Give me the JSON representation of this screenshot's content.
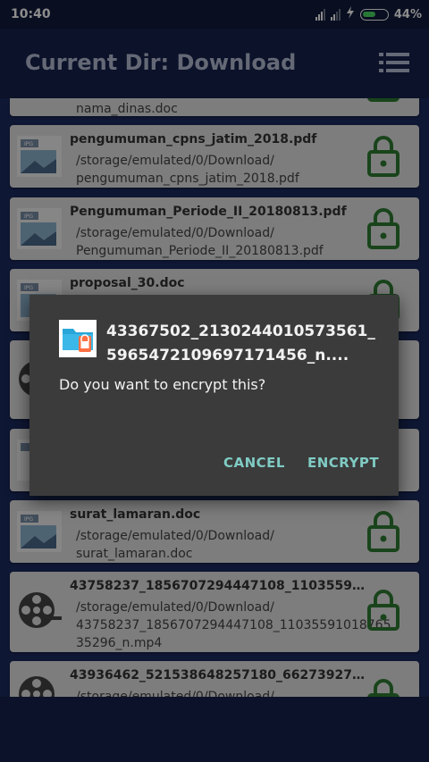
{
  "status_bar": {
    "time": "10:40",
    "battery": "44%"
  },
  "app_bar": {
    "title": "Current Dir: Download"
  },
  "files": [
    {
      "name": "",
      "path_line1": "",
      "path_line2": "nama_dinas.doc"
    },
    {
      "name": "pengumuman_cpns_jatim_2018.pdf",
      "path_line1": "/storage/emulated/0/Download/",
      "path_line2": "pengumuman_cpns_jatim_2018.pdf"
    },
    {
      "name": "Pengumuman_Periode_II_20180813.pdf",
      "path_line1": "/storage/emulated/0/Download/",
      "path_line2": "Pengumuman_Periode_II_20180813.pdf"
    },
    {
      "name": "proposal_30.doc",
      "path_line1": "",
      "path_line2": ""
    },
    {
      "name": "surat_lamaran.doc",
      "path_line1": "/storage/emulated/0/Download/",
      "path_line2": "surat_lamaran.doc"
    },
    {
      "name": "43758237_1856707294447108_11035591...",
      "path_line1": "/storage/emulated/0/Download/",
      "path_line2": "43758237_1856707294447108_110355910187653529​6_n.mp4"
    },
    {
      "name": "43936462_521538648257180_662739270...",
      "path_line1": "/storage/emulated/0/Download/",
      "path_line2": ""
    }
  ],
  "dialog": {
    "title": "43367502_2130244010573561_5965472109697171456_n....",
    "message": "Do you want to encrypt this?",
    "cancel_label": "CANCEL",
    "encrypt_label": "ENCRYPT"
  },
  "colors": {
    "lock_green": "#2e7d32",
    "accent_teal": "#80cbc4",
    "app_bar": "#15214b"
  }
}
